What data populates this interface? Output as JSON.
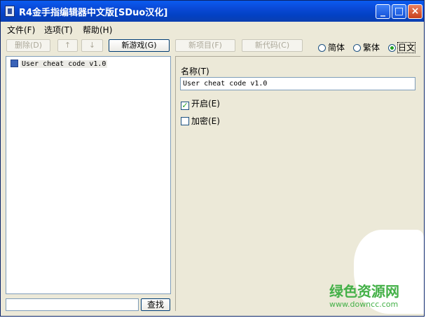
{
  "window": {
    "title": "R4金手指编辑器中文版[SDuo汉化]"
  },
  "title_buttons": {
    "minimize": "_",
    "maximize": "□",
    "close": "×"
  },
  "menu": {
    "items": [
      "文件(F)",
      "选项(T)",
      "帮助(H)"
    ]
  },
  "toolbar": {
    "delete_label": "删除(D)",
    "up_label": "↑",
    "down_label": "↓",
    "new_game_label": "新游戏(G)",
    "new_item_label": "新项目(F)",
    "new_code_label": "新代码(C)"
  },
  "language": {
    "simplified": "简体",
    "traditional": "繁体",
    "japanese": "日文",
    "selected": "日文"
  },
  "tree": {
    "items": [
      "User cheat code v1.0"
    ]
  },
  "search": {
    "value": "",
    "button_label": "查找"
  },
  "details": {
    "name_label": "名称(T)",
    "name_value": "User cheat code v1.0",
    "enable_label": "开启(E)",
    "enable_checked": true,
    "check_mark": "✓",
    "encrypt_label": "加密(E)",
    "encrypt_checked": false
  },
  "watermark": {
    "title": "绿色资源网",
    "url": "www.downcc.com"
  },
  "colors": {
    "accent": "#0a4ad8",
    "check": "#21a121",
    "watermark": "#43b047"
  }
}
